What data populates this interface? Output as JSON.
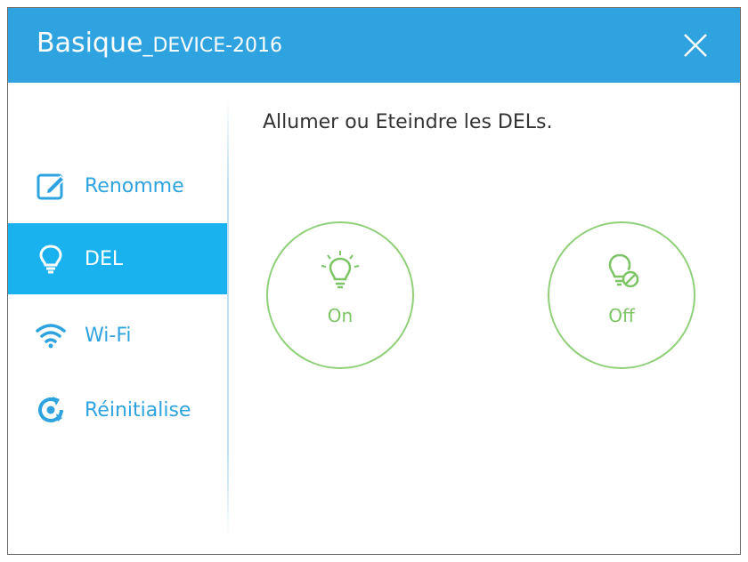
{
  "window": {
    "title_main": "Basique",
    "title_device": "_DEVICE-2016"
  },
  "sidebar": {
    "items": [
      {
        "label": "Renomme",
        "icon": "edit-icon"
      },
      {
        "label": "DEL",
        "icon": "lightbulb-icon",
        "active": true
      },
      {
        "label": "Wi-Fi",
        "icon": "wifi-icon"
      },
      {
        "label": "Réinitialise",
        "icon": "reset-icon"
      }
    ]
  },
  "main": {
    "instruction": "Allumer ou Eteindre les DELs.",
    "on_label": "On",
    "off_label": "Off"
  },
  "colors": {
    "titlebar": "#2fa3e0",
    "active_item": "#1ab2ee",
    "accent_green": "#8fd078"
  }
}
